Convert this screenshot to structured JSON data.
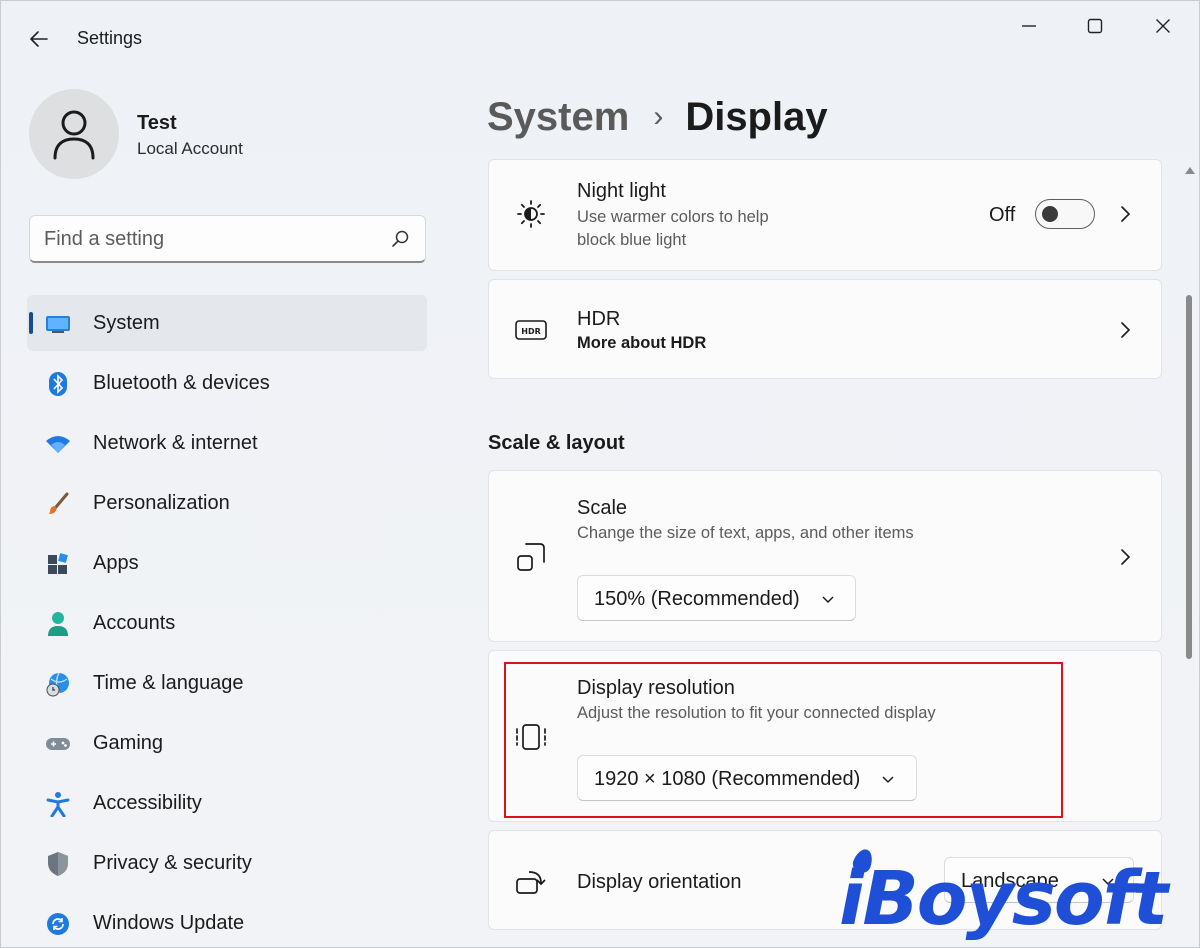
{
  "window": {
    "app_title": "Settings",
    "back_icon": "back-arrow-icon",
    "controls": [
      "minimize-icon",
      "maximize-icon",
      "close-icon"
    ]
  },
  "user": {
    "name": "Test",
    "account_type": "Local Account",
    "avatar_icon": "person-icon"
  },
  "search": {
    "placeholder": "Find a setting",
    "value": ""
  },
  "sidebar": {
    "items": [
      {
        "label": "System",
        "icon": "monitor-icon",
        "active": true
      },
      {
        "label": "Bluetooth & devices",
        "icon": "bluetooth-icon",
        "active": false
      },
      {
        "label": "Network & internet",
        "icon": "wifi-icon",
        "active": false
      },
      {
        "label": "Personalization",
        "icon": "brush-icon",
        "active": false
      },
      {
        "label": "Apps",
        "icon": "apps-icon",
        "active": false
      },
      {
        "label": "Accounts",
        "icon": "accounts-icon",
        "active": false
      },
      {
        "label": "Time & language",
        "icon": "globe-clock-icon",
        "active": false
      },
      {
        "label": "Gaming",
        "icon": "gamepad-icon",
        "active": false
      },
      {
        "label": "Accessibility",
        "icon": "accessibility-icon",
        "active": false
      },
      {
        "label": "Privacy & security",
        "icon": "shield-icon",
        "active": false
      },
      {
        "label": "Windows Update",
        "icon": "update-icon",
        "active": false
      }
    ]
  },
  "breadcrumb": {
    "parent": "System",
    "separator": "›",
    "current": "Display"
  },
  "night_light": {
    "title": "Night light",
    "description_line1": "Use warmer colors to help",
    "description_line2": "block blue light",
    "state_label": "Off",
    "enabled": false
  },
  "hdr": {
    "title": "HDR",
    "link": "More about HDR"
  },
  "scale_layout": {
    "section_title": "Scale & layout",
    "scale": {
      "title": "Scale",
      "description": "Change the size of text, apps, and other items",
      "value": "150% (Recommended)"
    },
    "resolution": {
      "title": "Display resolution",
      "description": "Adjust the resolution to fit your connected display",
      "value": "1920 × 1080 (Recommended)"
    },
    "orientation": {
      "title": "Display orientation",
      "value": "Landscape"
    }
  },
  "watermark": {
    "text": "iBoysoft"
  },
  "colors": {
    "accent": "#1a4b8f",
    "highlight_border": "#d9141c",
    "watermark": "#1f4fd6"
  }
}
